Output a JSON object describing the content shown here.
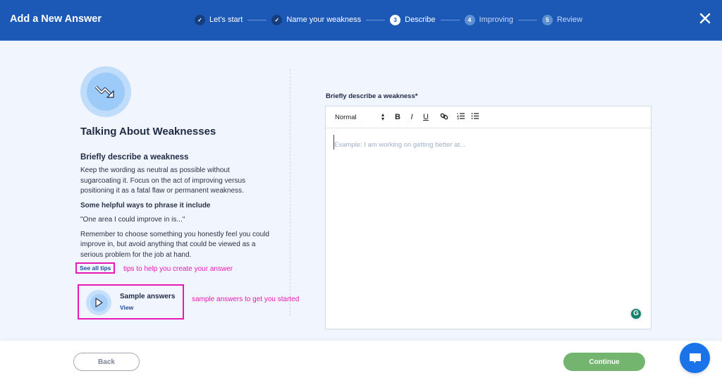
{
  "header": {
    "title": "Add a New Answer",
    "steps": [
      {
        "number": "✓",
        "label": "Let's start",
        "state": "done"
      },
      {
        "number": "✓",
        "label": "Name your weakness",
        "state": "done"
      },
      {
        "number": "3",
        "label": "Describe",
        "state": "active"
      },
      {
        "number": "4",
        "label": "Improving",
        "state": "todo"
      },
      {
        "number": "5",
        "label": "Review",
        "state": "todo"
      }
    ],
    "close_icon": "×"
  },
  "guide": {
    "title": "Talking About Weaknesses",
    "subtitle": "Briefly describe a weakness",
    "paragraph1": "Keep the wording as neutral as possible without sugarcoating it. Focus on the act of improving versus positioning it as a fatal flaw or permanent weakness.",
    "phrase_heading": "Some helpful ways to phrase it include",
    "phrase_example": "\"One area I could improve in is...\"",
    "paragraph2": "Remember to choose something you honestly feel you could improve in, but avoid anything that could be viewed as a serious problem for the job at hand.",
    "see_all_tips": "See all tips",
    "tips_annotation": "tips to help you create your answer",
    "sample_answers": {
      "title": "Sample answers",
      "link": "View",
      "annotation": "sample answers to get you started"
    }
  },
  "editor": {
    "label": "Briefly describe a weakness*",
    "format_select": "Normal",
    "toolbar": {
      "bold": "B",
      "italic": "I",
      "underline": "U"
    },
    "placeholder": "Example: I am working on getting better at...",
    "grammarly_badge": "G"
  },
  "footer": {
    "back_label": "Back",
    "continue_label": "Continue"
  }
}
